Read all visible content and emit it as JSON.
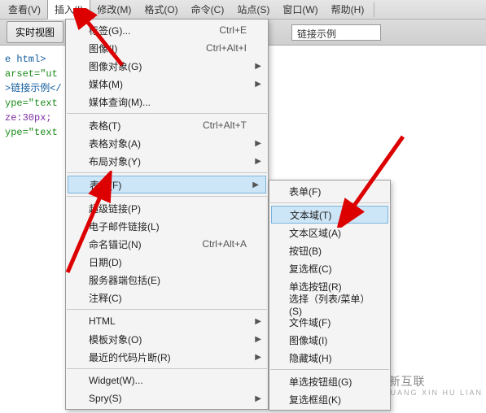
{
  "menubar": {
    "items": [
      "查看(V)",
      "插入(I)",
      "修改(M)",
      "格式(O)",
      "命令(C)",
      "站点(S)",
      "窗口(W)",
      "帮助(H)"
    ],
    "active_index": 1
  },
  "toolbar": {
    "tab_label": "实时视图",
    "title_value": "链接示例"
  },
  "code_lines": [
    {
      "cls": "c-blue",
      "text": "e html>"
    },
    {
      "cls": "",
      "text": ""
    },
    {
      "cls": "",
      "text": ""
    },
    {
      "cls": "",
      "text": ""
    },
    {
      "cls": "",
      "text": ""
    },
    {
      "cls": "c-green",
      "text": "arset=\"ut"
    },
    {
      "cls": "c-blue",
      "text": ">链接示例</"
    },
    {
      "cls": "c-green",
      "text": "ype=\"text"
    },
    {
      "cls": "",
      "text": ""
    },
    {
      "cls": "c-purple",
      "text": "ze:30px;"
    },
    {
      "cls": "",
      "text": ""
    },
    {
      "cls": "",
      "text": ""
    },
    {
      "cls": "",
      "text": ""
    },
    {
      "cls": "",
      "text": ""
    },
    {
      "cls": "",
      "text": ""
    },
    {
      "cls": "c-green",
      "text": "ype=\"text"
    }
  ],
  "dropdown": [
    {
      "type": "item",
      "label": "标签(G)...",
      "shortcut": "Ctrl+E"
    },
    {
      "type": "item",
      "label": "图像(I)",
      "shortcut": "Ctrl+Alt+I"
    },
    {
      "type": "item",
      "label": "图像对象(G)",
      "arrow": true
    },
    {
      "type": "item",
      "label": "媒体(M)",
      "arrow": true
    },
    {
      "type": "item",
      "label": "媒体查询(M)..."
    },
    {
      "type": "sep"
    },
    {
      "type": "item",
      "label": "表格(T)",
      "shortcut": "Ctrl+Alt+T"
    },
    {
      "type": "item",
      "label": "表格对象(A)",
      "arrow": true
    },
    {
      "type": "item",
      "label": "布局对象(Y)",
      "arrow": true
    },
    {
      "type": "sep"
    },
    {
      "type": "item",
      "label": "表单(F)",
      "arrow": true,
      "highlight": true
    },
    {
      "type": "sep"
    },
    {
      "type": "item",
      "label": "超级链接(P)"
    },
    {
      "type": "item",
      "label": "电子邮件链接(L)"
    },
    {
      "type": "item",
      "label": "命名锚记(N)",
      "shortcut": "Ctrl+Alt+A"
    },
    {
      "type": "item",
      "label": "日期(D)"
    },
    {
      "type": "item",
      "label": "服务器端包括(E)"
    },
    {
      "type": "item",
      "label": "注释(C)"
    },
    {
      "type": "sep"
    },
    {
      "type": "item",
      "label": "HTML",
      "arrow": true
    },
    {
      "type": "item",
      "label": "模板对象(O)",
      "arrow": true
    },
    {
      "type": "item",
      "label": "最近的代码片断(R)",
      "arrow": true
    },
    {
      "type": "sep"
    },
    {
      "type": "item",
      "label": "Widget(W)..."
    },
    {
      "type": "item",
      "label": "Spry(S)",
      "arrow": true
    }
  ],
  "submenu": [
    {
      "type": "item",
      "label": "表单(F)"
    },
    {
      "type": "sep"
    },
    {
      "type": "item",
      "label": "文本域(T)",
      "highlight": true
    },
    {
      "type": "item",
      "label": "文本区域(A)"
    },
    {
      "type": "item",
      "label": "按钮(B)"
    },
    {
      "type": "item",
      "label": "复选框(C)"
    },
    {
      "type": "item",
      "label": "单选按钮(R)"
    },
    {
      "type": "item",
      "label": "选择（列表/菜单）(S)"
    },
    {
      "type": "item",
      "label": "文件域(F)"
    },
    {
      "type": "item",
      "label": "图像域(I)"
    },
    {
      "type": "item",
      "label": "隐藏域(H)"
    },
    {
      "type": "sep"
    },
    {
      "type": "item",
      "label": "单选按钮组(G)"
    },
    {
      "type": "item",
      "label": "复选框组(K)"
    }
  ],
  "logo": {
    "brand": "创新互联",
    "tagline": "CHUANG XIN HU LIAN"
  }
}
